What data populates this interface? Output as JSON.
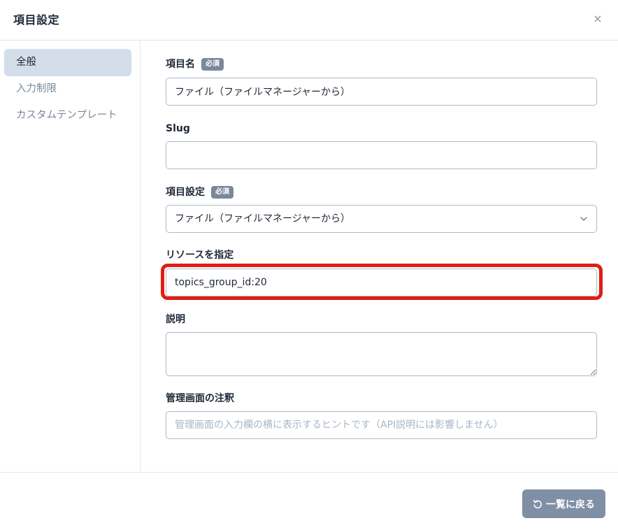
{
  "modal": {
    "title": "項目設定",
    "close_icon": "close-icon",
    "close_label": "×"
  },
  "sidebar": {
    "items": [
      {
        "label": "全般",
        "active": true
      },
      {
        "label": "入力制限",
        "active": false
      },
      {
        "label": "カスタムテンプレート",
        "active": false
      }
    ]
  },
  "form": {
    "item_name": {
      "label": "項目名",
      "badge": "必須",
      "value": "ファイル（ファイルマネージャーから）"
    },
    "slug": {
      "label": "Slug",
      "value": ""
    },
    "item_setting": {
      "label": "項目設定",
      "badge": "必須",
      "selected": "ファイル（ファイルマネージャーから）"
    },
    "resource": {
      "label": "リソースを指定",
      "value": "topics_group_id:20"
    },
    "description": {
      "label": "説明",
      "value": ""
    },
    "admin_note": {
      "label": "管理画面の注釈",
      "value": "",
      "placeholder": "管理画面の入力欄の横に表示するヒントです（API説明には影響しません）"
    }
  },
  "footer": {
    "back_label": "一覧に戻る",
    "back_icon": "undo-icon"
  },
  "colors": {
    "highlight": "#e01e14",
    "active_nav_bg": "#d4deea",
    "badge_bg": "#7a889b",
    "button_bg": "#7f8fa5"
  }
}
